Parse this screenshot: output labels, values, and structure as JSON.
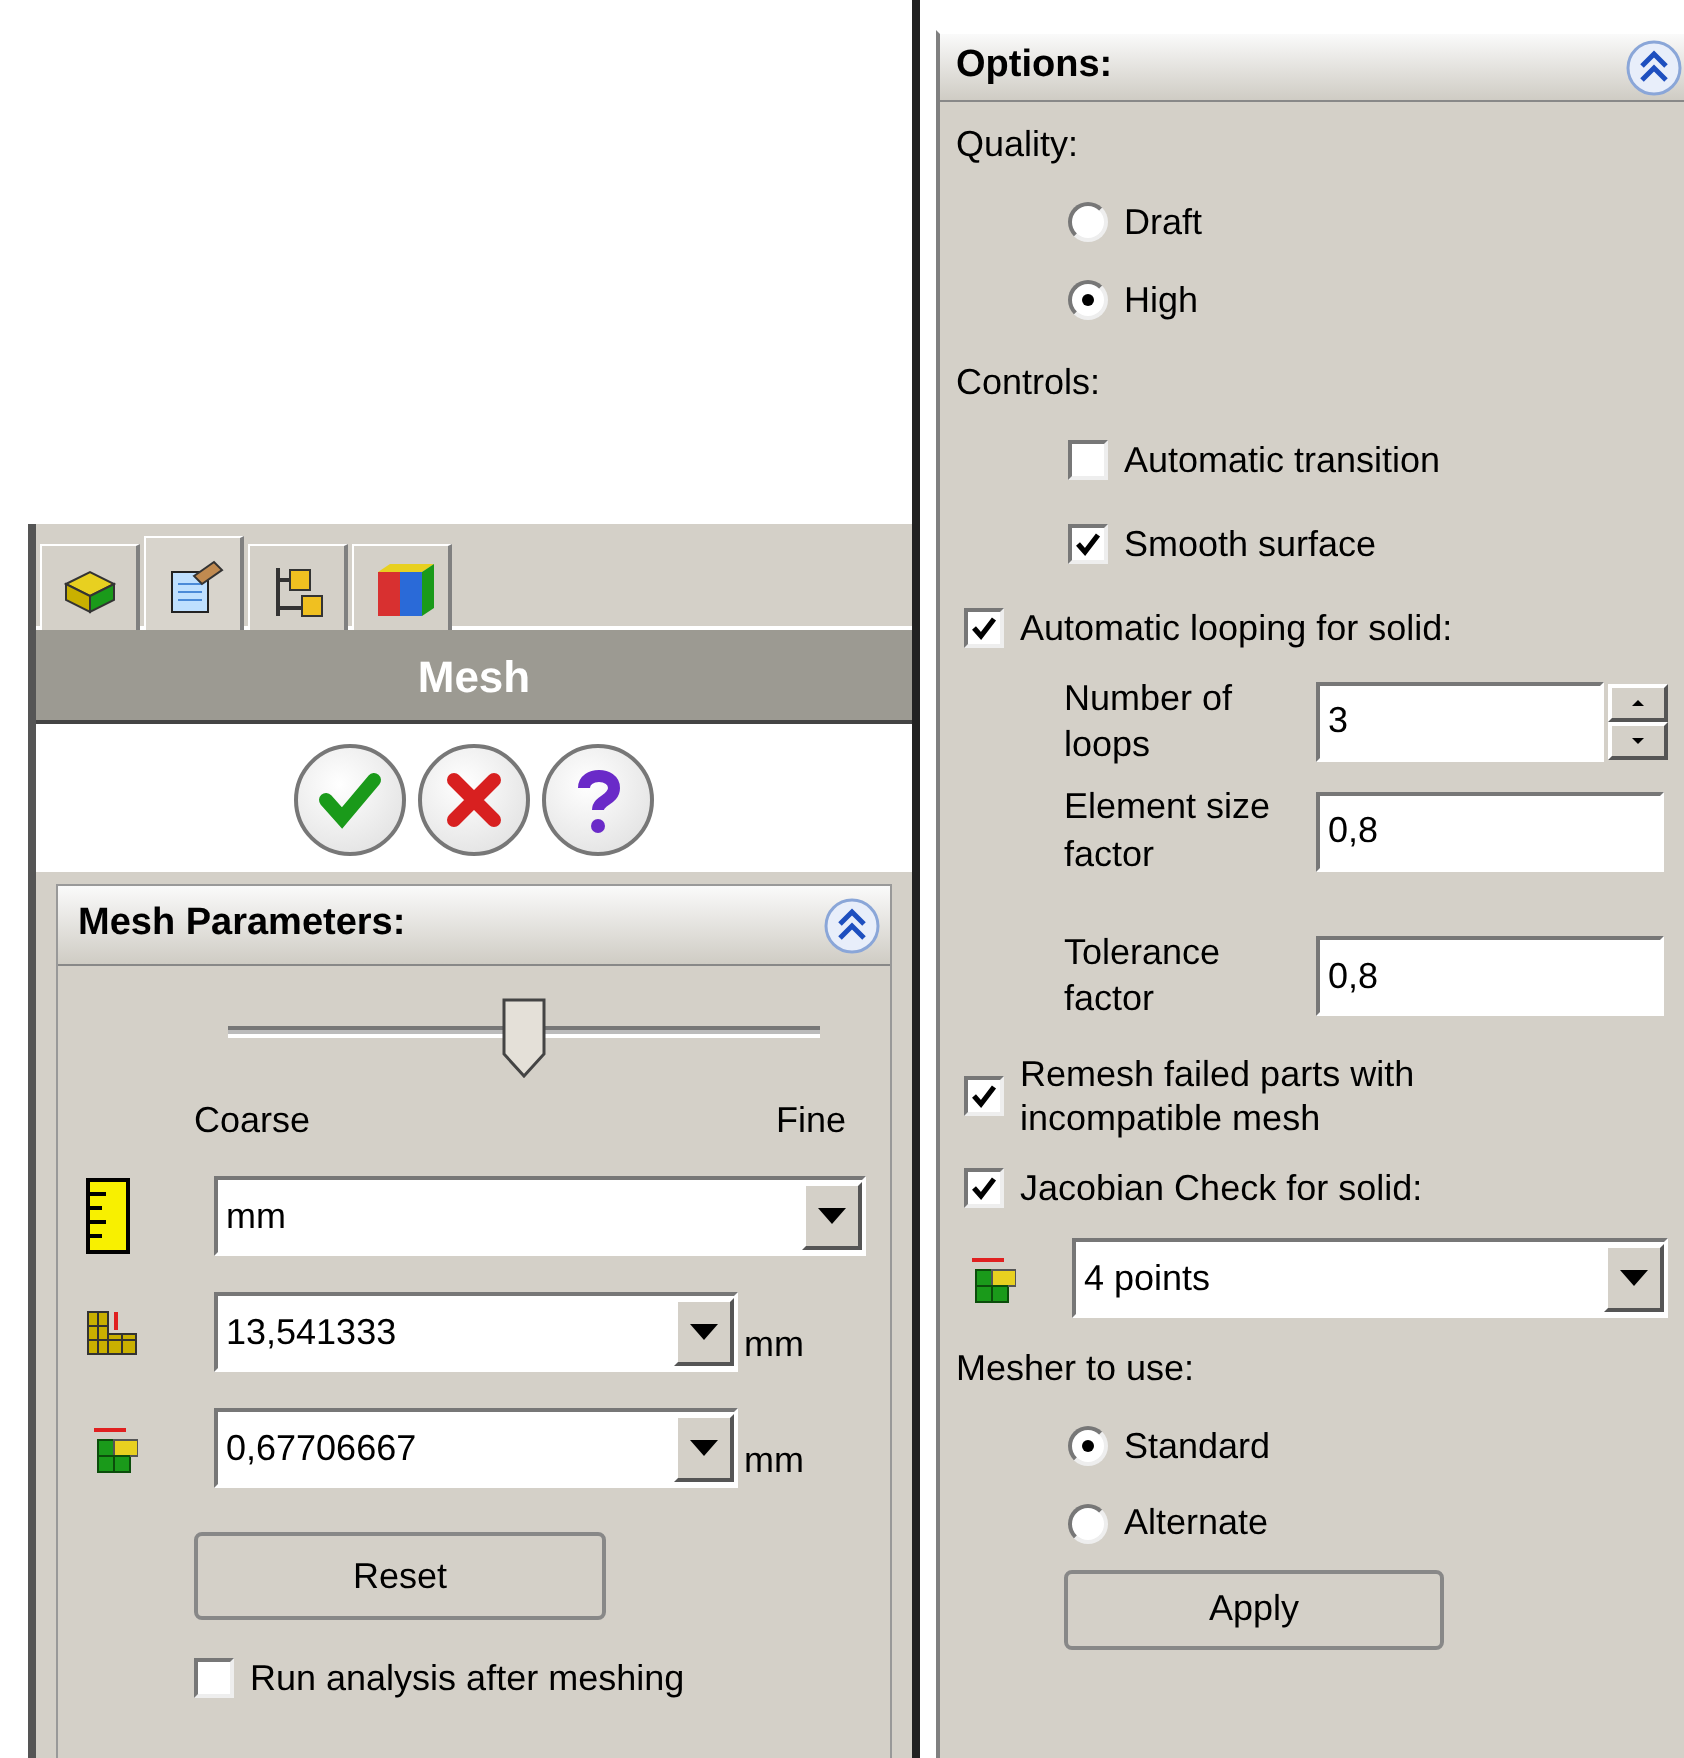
{
  "tabs": [
    {
      "kind": "part",
      "selected": false
    },
    {
      "kind": "properties",
      "selected": true
    },
    {
      "kind": "configuration",
      "selected": false
    },
    {
      "kind": "cube",
      "selected": false
    }
  ],
  "panel_title": "Mesh",
  "mesh_parameters": {
    "title": "Mesh Parameters:",
    "slider": {
      "level": 0.5,
      "left_label": "Coarse",
      "right_label": "Fine"
    },
    "unit": {
      "value": "mm"
    },
    "sizes": [
      {
        "kind": "global",
        "value": "13,541333",
        "unit": "mm"
      },
      {
        "kind": "tolerance",
        "value": "0,67706667",
        "unit": "mm"
      }
    ],
    "reset": "Reset",
    "run_analysis": {
      "label": "Run analysis after meshing",
      "checked": false
    }
  },
  "options": {
    "title": "Options:",
    "quality": {
      "label": "Quality:",
      "options": [
        {
          "label": "Draft",
          "selected": false
        },
        {
          "label": "High",
          "selected": true
        }
      ]
    },
    "controls": {
      "label": "Controls:",
      "items": [
        {
          "label": "Automatic transition",
          "checked": false
        },
        {
          "label": "Smooth surface",
          "checked": true
        }
      ]
    },
    "looping": {
      "label": "Automatic looping for solid:",
      "checked": true,
      "fields": [
        {
          "kind": "spin",
          "label": "Number of loops",
          "value": "3"
        },
        {
          "kind": "text",
          "label": "Element size factor",
          "value": "0,8"
        },
        {
          "kind": "text",
          "label": "Tolerance factor",
          "value": "0,8"
        }
      ]
    },
    "remesh": {
      "label": "Remesh failed parts with incompatible mesh",
      "checked": true
    },
    "jacobian": {
      "label": "Jacobian Check for solid:",
      "checked": true,
      "value": "4 points"
    },
    "mesher": {
      "label": "Mesher to use:",
      "options": [
        {
          "label": "Standard",
          "selected": true
        },
        {
          "label": "Alternate",
          "selected": false
        }
      ]
    },
    "apply": "Apply"
  }
}
